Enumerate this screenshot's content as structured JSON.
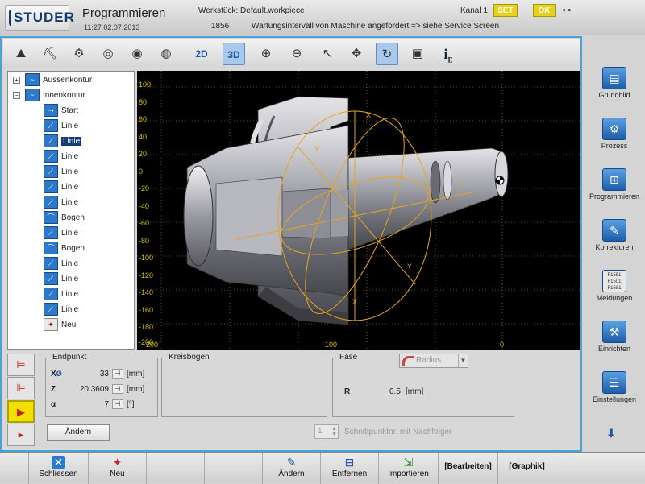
{
  "header": {
    "logo_text": "STUDER",
    "title": "Programmieren",
    "datetime": "11:27  02.07.2013",
    "workpiece": "Werkstück: Default.workpiece",
    "counter": "1856",
    "warning": "Wartungsintervall von Maschine angefordert => siehe Service Screen",
    "channel": "Kanal 1",
    "set_label": "SET",
    "ok_label": "OK"
  },
  "toolbar": {
    "view_2d": "2D",
    "view_3d": "3D",
    "info_label": "i",
    "info_sub": "E"
  },
  "tree": {
    "items": [
      {
        "label": "Aussenkontur"
      },
      {
        "label": "Innenkontur"
      },
      {
        "label": "Start"
      },
      {
        "label": "Linie"
      },
      {
        "label": "Linie"
      },
      {
        "label": "Linie"
      },
      {
        "label": "Linie"
      },
      {
        "label": "Linie"
      },
      {
        "label": "Linie"
      },
      {
        "label": "Bogen"
      },
      {
        "label": "Linie"
      },
      {
        "label": "Bogen"
      },
      {
        "label": "Linie"
      },
      {
        "label": "Linie"
      },
      {
        "label": "Linie"
      },
      {
        "label": "Linie"
      },
      {
        "label": "Neu"
      }
    ]
  },
  "viewport": {
    "y_ticks": [
      "100",
      "80",
      "60",
      "40",
      "20",
      "0",
      "-20",
      "-40",
      "-60",
      "-80",
      "-100",
      "-120",
      "-140",
      "-160",
      "-180",
      "-200"
    ],
    "x_ticks": [
      "-200",
      "-100",
      "0"
    ],
    "axis_x": "X",
    "axis_y": "Y",
    "axis_z": "Z"
  },
  "endpunkt": {
    "title": "Endpunkt",
    "x_label": "X",
    "x_sub": "Ø",
    "x_value": "33",
    "x_unit": "[mm]",
    "z_label": "Z",
    "z_value": "20.3609",
    "z_unit": "[mm]",
    "alpha_label": "α",
    "alpha_value": "7",
    "alpha_unit": "[°]"
  },
  "kreisbogen": {
    "title": "Kreisbogen"
  },
  "fase": {
    "title": "Fase",
    "select_value": "Radius",
    "r_label": "R",
    "r_value": "0.5",
    "r_unit": "[mm]"
  },
  "aendern_label": "Ändern",
  "schnittpunkt": {
    "value": "1",
    "label": "Schnittpunktnr. mit Nachfolger"
  },
  "right_menu": [
    {
      "label": "Grundbild"
    },
    {
      "label": "Prozess"
    },
    {
      "label": "Programmieren"
    },
    {
      "label": "Korrekturen"
    },
    {
      "label": "Meldungen"
    },
    {
      "label": "Einrichten"
    },
    {
      "label": "Einstellungen"
    }
  ],
  "meldungen_codes": [
    "F1551",
    "F1501",
    "F1681"
  ],
  "bottom": {
    "schliessen": "Schliessen",
    "neu": "Neu",
    "aendern": "Ändern",
    "entfernen": "Entfernen",
    "importieren": "Importieren",
    "bearbeiten": "[Bearbeiten]",
    "graphik": "[Graphik]"
  }
}
